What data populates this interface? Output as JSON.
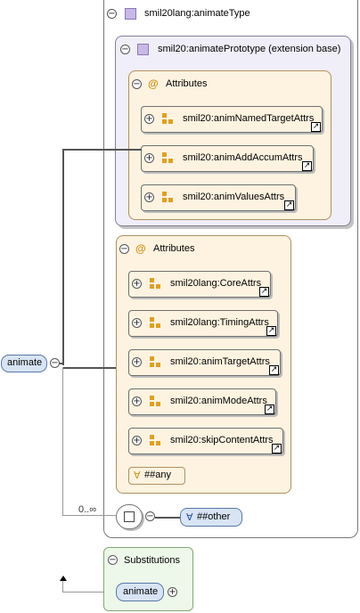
{
  "root_element": {
    "name": "animate"
  },
  "complex_type": {
    "name": "smil20lang:animateType"
  },
  "extension_base": {
    "name": "smil20:animatePrototype (extension base)"
  },
  "base_attributes": {
    "header": "Attributes",
    "groups": [
      "smil20:animNamedTargetAttrs",
      "smil20:animAddAccumAttrs",
      "smil20:animValuesAttrs"
    ]
  },
  "attributes": {
    "header": "Attributes",
    "groups": [
      "smil20lang:CoreAttrs",
      "smil20lang:TimingAttrs",
      "smil20:animTargetAttrs",
      "smil20:animModeAttrs",
      "smil20:skipContentAttrs"
    ],
    "any_attribute": "##any"
  },
  "sequence": {
    "cardinality": "0..∞",
    "any_element": "##other"
  },
  "substitutions": {
    "header": "Substitutions",
    "element": "animate"
  },
  "icons": {
    "expand": "plus-in-circle",
    "collapse": "minus-in-circle",
    "attribute": "at-sign",
    "attribute_group": "orange-squares",
    "reference_link": "arrow-link",
    "any_wildcard": "for-all"
  },
  "colors": {
    "attribute_box_fill": "#fdf3e0",
    "extension_box_fill": "#f0eef8",
    "element_fill": "#d8e4f4",
    "substitution_box_fill": "#eef8ea"
  }
}
